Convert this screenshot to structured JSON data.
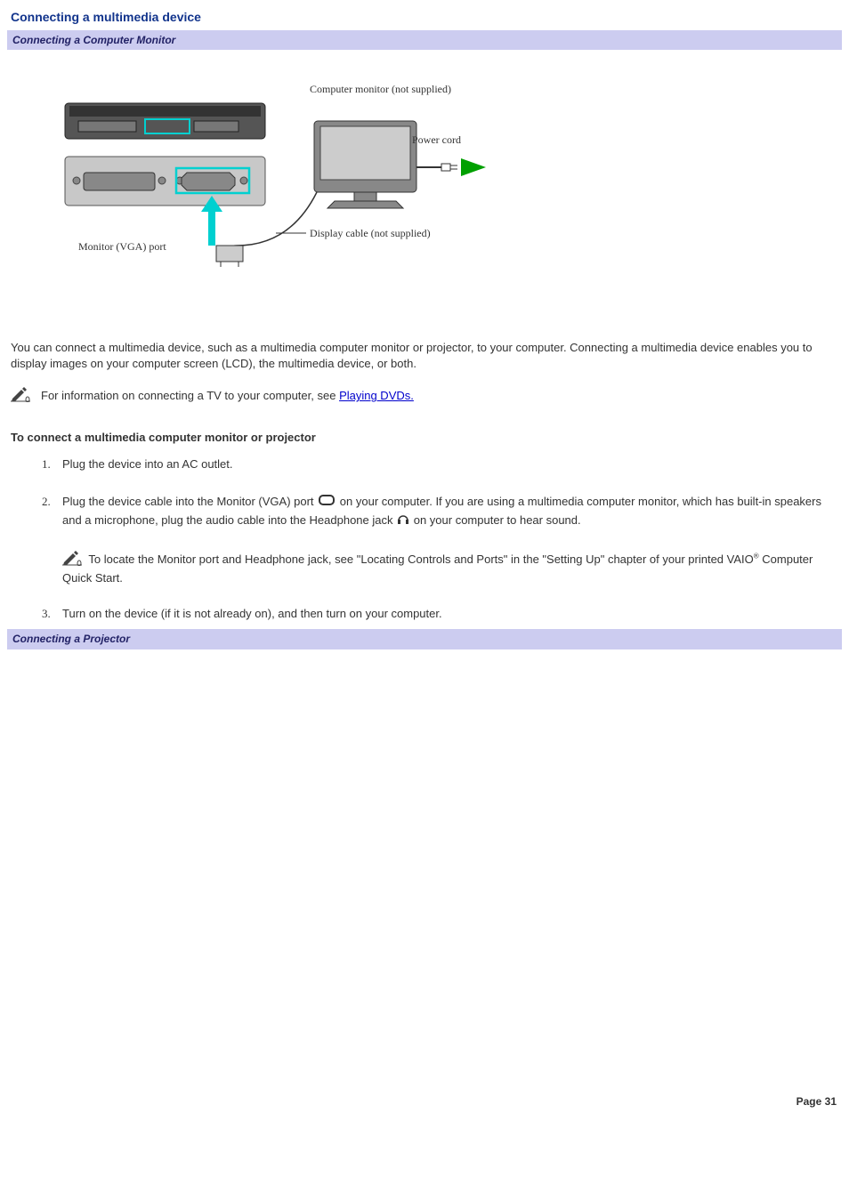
{
  "title": "Connecting a multimedia device",
  "section1": "Connecting a Computer Monitor",
  "diagram": {
    "label_monitor": "Computer monitor (not supplied)",
    "label_power": "Power cord",
    "label_display_cable": "Display cable (not supplied)",
    "label_vga": "Monitor (VGA) port"
  },
  "intro": "You can connect a multimedia device, such as a multimedia computer monitor or projector, to your computer. Connecting a multimedia device enables you to display images on your computer screen (LCD), the multimedia device, or both.",
  "note1_pre": "For information on connecting a TV to your computer, see ",
  "note1_link": "Playing DVDs.",
  "subheading": "To connect a multimedia computer monitor or projector",
  "steps": {
    "s1": "Plug the device into an AC outlet.",
    "s2a": "Plug the device cable into the Monitor (VGA) port ",
    "s2b": " on your computer. If you are using a multimedia computer monitor, which has built-in speakers and a microphone, plug the audio cable into the Headphone jack ",
    "s2c": " on your computer to hear sound.",
    "s2_note_a": " To locate the Monitor port and Headphone jack, see \"Locating Controls and Ports\" in the \"Setting Up\" chapter of your printed VAIO",
    "s2_note_b": " Computer Quick Start.",
    "s3": "Turn on the device (if it is not already on), and then turn on your computer."
  },
  "section2": "Connecting a Projector",
  "page_num": "Page 31"
}
